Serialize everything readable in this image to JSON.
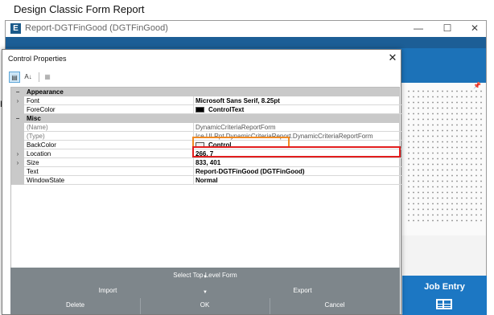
{
  "page_title": "Design Classic Form Report",
  "app": {
    "window_title": "Report-DGTFinGood (DGTFinGood)",
    "logo_letter": "E",
    "job_entry_label": "Job Entry",
    "left_edge_char": "H"
  },
  "dialog": {
    "title": "Control Properties",
    "close_glyph": "✕"
  },
  "toolbar": {
    "categorized_glyph": "▤",
    "alphabetical_glyph": "A↓",
    "pages_glyph": "▦"
  },
  "properties": {
    "appearance": {
      "label": "Appearance",
      "font": {
        "name": "Font",
        "value": "Microsoft Sans Serif, 8.25pt"
      },
      "forecolor": {
        "name": "ForeColor",
        "value": "ControlText",
        "color": "#000000"
      }
    },
    "misc": {
      "label": "Misc",
      "name": {
        "name": "(Name)",
        "value": "DynamicCriteriaReportForm"
      },
      "type": {
        "name": "(Type)",
        "value": "Ice.UI.Rpt.DynamicCriteriaReport.DynamicCriteriaReportForm"
      },
      "backcolor": {
        "name": "BackColor",
        "value": "Control",
        "color": "#f0f0f0"
      },
      "location": {
        "name": "Location",
        "value": "266, 7"
      },
      "size": {
        "name": "Size",
        "value": "833, 401"
      },
      "text": {
        "name": "Text",
        "value": "Report-DGTFinGood (DGTFinGood)"
      },
      "windowstate": {
        "name": "WindowState",
        "value": "Normal"
      }
    }
  },
  "buttons": {
    "select_top": "Select Top Level Form",
    "import": "Import",
    "export": "Export",
    "delete": "Delete",
    "ok": "OK",
    "cancel": "Cancel"
  },
  "colors": {
    "highlight_name": "#f08a24",
    "highlight_type": "#e21e1e",
    "button_panel": "#7e868b",
    "app_blue": "#1c72b8"
  }
}
